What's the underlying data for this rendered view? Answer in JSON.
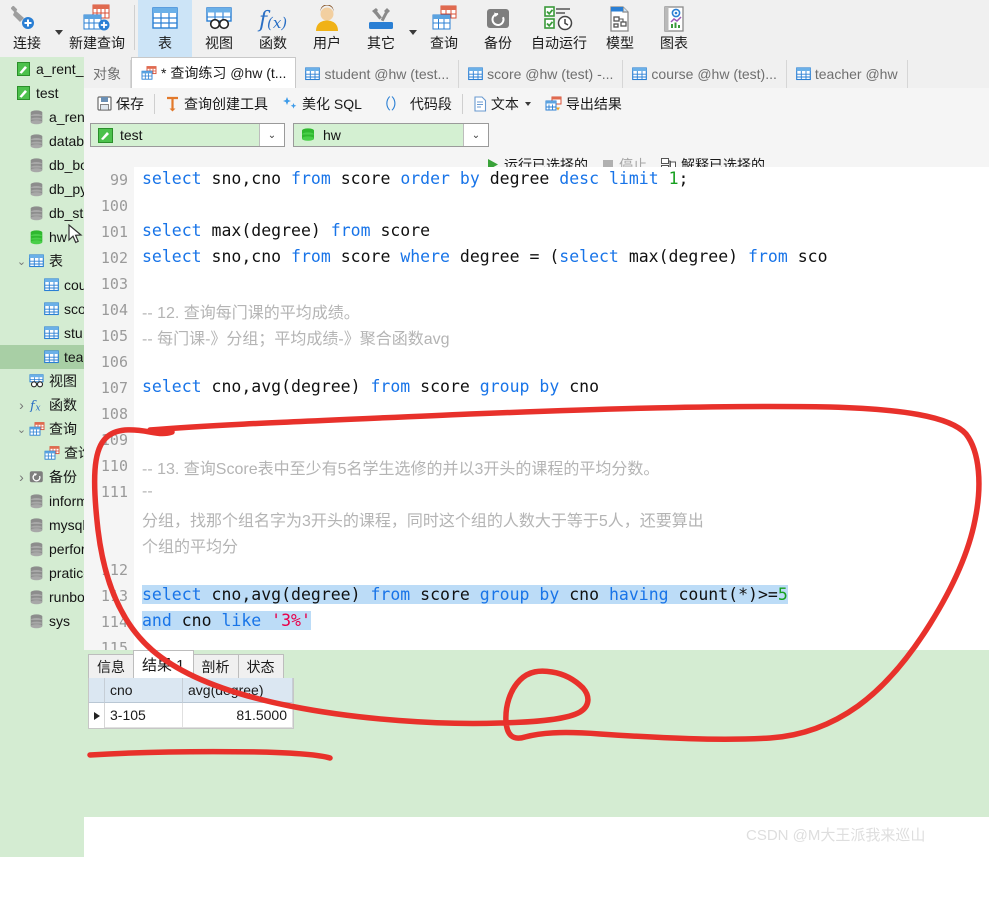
{
  "app": "Navicat",
  "colors": {
    "sidebar_bg": "#d4ecd2",
    "ribbon_bg": "#f0f0f0",
    "selection_blue": "#bcdcf7",
    "ribbon_selected": "#cce4f7",
    "keyword_blue": "#1874e8",
    "string_red": "#e8004a",
    "number_green": "#17a020",
    "comment_gray": "#b4b4b4",
    "annotation_red": "#e8312b",
    "watermark_gray": "#dedede"
  },
  "ribbon": {
    "items": [
      {
        "label": "连接",
        "icon": "connection-plus-icon",
        "selected": false,
        "caret": true
      },
      {
        "label": "新建查询",
        "icon": "new-query-icon",
        "selected": false,
        "caret": false
      },
      {
        "label": "表",
        "icon": "table-icon",
        "selected": true,
        "caret": false
      },
      {
        "label": "视图",
        "icon": "view-icon",
        "selected": false,
        "caret": false
      },
      {
        "label": "函数",
        "icon": "function-fx-icon",
        "selected": false,
        "caret": false
      },
      {
        "label": "用户",
        "icon": "user-icon",
        "selected": false,
        "caret": false
      },
      {
        "label": "其它",
        "icon": "other-tools-icon",
        "selected": false,
        "caret": true
      },
      {
        "label": "查询",
        "icon": "query-icon",
        "selected": false,
        "caret": false
      },
      {
        "label": "备份",
        "icon": "backup-icon",
        "selected": false,
        "caret": false
      },
      {
        "label": "自动运行",
        "icon": "auto-run-icon",
        "selected": false,
        "caret": false
      },
      {
        "label": "模型",
        "icon": "model-icon",
        "selected": false,
        "caret": false
      },
      {
        "label": "图表",
        "icon": "chart-icon",
        "selected": false,
        "caret": false
      }
    ]
  },
  "sidebar": {
    "items": [
      {
        "label": "a_rent_hou",
        "icon": "connection-icon",
        "indent": 1,
        "twisty": "",
        "selected": false
      },
      {
        "label": "test",
        "icon": "connection-icon",
        "indent": 1,
        "twisty": "",
        "selected": false
      },
      {
        "label": "a_rent_h",
        "icon": "database-icon",
        "indent": 2,
        "twisty": "",
        "selected": false
      },
      {
        "label": "databas",
        "icon": "database-icon",
        "indent": 2,
        "twisty": "",
        "selected": false
      },
      {
        "label": "db_bool",
        "icon": "database-icon",
        "indent": 2,
        "twisty": "",
        "selected": false
      },
      {
        "label": "db_pyto",
        "icon": "database-icon",
        "indent": 2,
        "twisty": "",
        "selected": false
      },
      {
        "label": "db_stu",
        "icon": "database-icon",
        "indent": 2,
        "twisty": "",
        "selected": false
      },
      {
        "label": "hw",
        "icon": "database-open-icon",
        "indent": 2,
        "twisty": "",
        "selected": false
      },
      {
        "label": "表",
        "icon": "table-folder-icon",
        "indent": 2,
        "twisty": "v",
        "selected": false
      },
      {
        "label": "cou",
        "icon": "table-icon",
        "indent": 3,
        "twisty": "",
        "selected": false
      },
      {
        "label": "sco",
        "icon": "table-icon",
        "indent": 3,
        "twisty": "",
        "selected": false
      },
      {
        "label": "stu",
        "icon": "table-icon",
        "indent": 3,
        "twisty": "",
        "selected": false
      },
      {
        "label": "tea",
        "icon": "table-icon",
        "indent": 3,
        "twisty": "",
        "selected": true
      },
      {
        "label": "视图",
        "icon": "view-folder-icon",
        "indent": 2,
        "twisty": "",
        "selected": false
      },
      {
        "label": "函数",
        "icon": "function-folder-icon",
        "indent": 2,
        "twisty": ">",
        "selected": false
      },
      {
        "label": "查询",
        "icon": "query-folder-icon",
        "indent": 2,
        "twisty": "v",
        "selected": false
      },
      {
        "label": "查询",
        "icon": "query-icon",
        "indent": 3,
        "twisty": "",
        "selected": false
      },
      {
        "label": "备份",
        "icon": "backup-folder-icon",
        "indent": 2,
        "twisty": ">",
        "selected": false
      },
      {
        "label": "informat",
        "icon": "database-icon",
        "indent": 2,
        "twisty": "",
        "selected": false
      },
      {
        "label": "mysql",
        "icon": "database-icon",
        "indent": 2,
        "twisty": "",
        "selected": false
      },
      {
        "label": "perform",
        "icon": "database-icon",
        "indent": 2,
        "twisty": "",
        "selected": false
      },
      {
        "label": "pratice",
        "icon": "database-icon",
        "indent": 2,
        "twisty": "",
        "selected": false
      },
      {
        "label": "runbook",
        "icon": "database-icon",
        "indent": 2,
        "twisty": "",
        "selected": false
      },
      {
        "label": "sys",
        "icon": "database-icon",
        "indent": 2,
        "twisty": "",
        "selected": false
      }
    ],
    "cursor": "mouse-pointer"
  },
  "tabs": [
    {
      "label": "对象",
      "icon": "",
      "active": false
    },
    {
      "label": "* 查询练习 @hw (t...",
      "icon": "query-icon",
      "active": true
    },
    {
      "label": "student @hw (test...",
      "icon": "table-icon",
      "active": false
    },
    {
      "label": "score @hw (test) -...",
      "icon": "table-icon",
      "active": false
    },
    {
      "label": "course @hw (test)...",
      "icon": "table-icon",
      "active": false
    },
    {
      "label": "teacher @hw",
      "icon": "table-icon",
      "active": false
    }
  ],
  "editor_toolbar": {
    "buttons": [
      {
        "label": "保存",
        "icon": "save-icon",
        "caret": false
      },
      {
        "label": "查询创建工具",
        "icon": "query-builder-icon",
        "caret": false
      },
      {
        "label": "美化 SQL",
        "icon": "beautify-icon",
        "caret": false
      },
      {
        "label": "代码段",
        "icon": "code-snippet-icon",
        "caret": false
      },
      {
        "label": "文本",
        "icon": "text-icon",
        "caret": true
      },
      {
        "label": "导出结果",
        "icon": "export-icon",
        "caret": false
      }
    ]
  },
  "connection_bar": {
    "connection": {
      "value": "test",
      "icon": "connection-icon"
    },
    "database": {
      "value": "hw",
      "icon": "database-icon"
    }
  },
  "run_bar": {
    "run_selected": {
      "label": "运行已选择的",
      "icon": "play-icon",
      "disabled": false
    },
    "stop": {
      "label": "停止",
      "icon": "stop-icon",
      "disabled": true
    },
    "explain_selected": {
      "label": "解释已选择的",
      "icon": "explain-icon",
      "disabled": false
    }
  },
  "code": {
    "lines": [
      {
        "num": "99",
        "type": "sql",
        "segments": [
          {
            "t": "select ",
            "c": "kw"
          },
          {
            "t": "sno,cno ",
            "c": ""
          },
          {
            "t": "from ",
            "c": "kw"
          },
          {
            "t": "score ",
            "c": ""
          },
          {
            "t": "order ",
            "c": "kw"
          },
          {
            "t": "by ",
            "c": "kw"
          },
          {
            "t": "degree ",
            "c": ""
          },
          {
            "t": "desc ",
            "c": "kw"
          },
          {
            "t": "limit ",
            "c": "kw"
          },
          {
            "t": "1",
            "c": "num"
          },
          {
            "t": ";",
            "c": ""
          }
        ]
      },
      {
        "num": "100",
        "type": "blank",
        "segments": []
      },
      {
        "num": "101",
        "type": "sql",
        "segments": [
          {
            "t": "select ",
            "c": "kw"
          },
          {
            "t": "max(degree) ",
            "c": ""
          },
          {
            "t": "from ",
            "c": "kw"
          },
          {
            "t": "score",
            "c": ""
          }
        ]
      },
      {
        "num": "102",
        "type": "sql",
        "segments": [
          {
            "t": "select ",
            "c": "kw"
          },
          {
            "t": "sno,cno ",
            "c": ""
          },
          {
            "t": "from ",
            "c": "kw"
          },
          {
            "t": "score ",
            "c": ""
          },
          {
            "t": "where ",
            "c": "kw"
          },
          {
            "t": "degree = (",
            "c": ""
          },
          {
            "t": "select ",
            "c": "kw"
          },
          {
            "t": "max(degree) ",
            "c": ""
          },
          {
            "t": "from ",
            "c": "kw"
          },
          {
            "t": "sco",
            "c": ""
          }
        ]
      },
      {
        "num": "103",
        "type": "blank",
        "segments": []
      },
      {
        "num": "104",
        "type": "comment",
        "segments": [
          {
            "t": "-- 12. 查询每门课的平均成绩。",
            "c": "cmt"
          }
        ]
      },
      {
        "num": "105",
        "type": "comment",
        "segments": [
          {
            "t": "-- 每门课-》分组；平均成绩-》聚合函数avg",
            "c": "cmt"
          }
        ]
      },
      {
        "num": "106",
        "type": "blank",
        "segments": []
      },
      {
        "num": "107",
        "type": "sql",
        "segments": [
          {
            "t": "select ",
            "c": "kw"
          },
          {
            "t": "cno,avg(degree) ",
            "c": ""
          },
          {
            "t": "from ",
            "c": "kw"
          },
          {
            "t": "score ",
            "c": ""
          },
          {
            "t": "group ",
            "c": "kw"
          },
          {
            "t": "by ",
            "c": "kw"
          },
          {
            "t": "cno",
            "c": ""
          }
        ]
      },
      {
        "num": "108",
        "type": "blank",
        "segments": []
      },
      {
        "num": "109",
        "type": "blank",
        "segments": []
      },
      {
        "num": "110",
        "type": "comment",
        "segments": [
          {
            "t": "-- 13. 查询Score表中至少有5名学生选修的并以3开头的课程的平均分数。",
            "c": "cmt"
          }
        ]
      },
      {
        "num": "111",
        "type": "comment",
        "segments": [
          {
            "t": "--",
            "c": "cmt"
          }
        ]
      },
      {
        "num": "",
        "type": "comment",
        "segments": [
          {
            "t": "分组，找那个组名字为3开头的课程，同时这个组的人数大于等于5人，还要算出",
            "c": "cmt"
          }
        ]
      },
      {
        "num": "",
        "type": "comment",
        "segments": [
          {
            "t": "个组的平均分",
            "c": "cmt"
          }
        ]
      },
      {
        "num": "112",
        "type": "blank",
        "segments": []
      },
      {
        "num": "113",
        "type": "sql-sel",
        "segments": [
          {
            "t": "select ",
            "c": "kw"
          },
          {
            "t": "cno,avg(degree) ",
            "c": ""
          },
          {
            "t": "from ",
            "c": "kw"
          },
          {
            "t": "score ",
            "c": ""
          },
          {
            "t": "group ",
            "c": "kw"
          },
          {
            "t": "by ",
            "c": "kw"
          },
          {
            "t": "cno ",
            "c": ""
          },
          {
            "t": "having ",
            "c": "kw"
          },
          {
            "t": "count(*)>=",
            "c": ""
          },
          {
            "t": "5",
            "c": "num"
          }
        ]
      },
      {
        "num": "114",
        "type": "sql-sel",
        "segments": [
          {
            "t": "and ",
            "c": "kw"
          },
          {
            "t": "cno ",
            "c": ""
          },
          {
            "t": "like ",
            "c": "kw"
          },
          {
            "t": "'3%'",
            "c": "str"
          }
        ]
      },
      {
        "num": "115",
        "type": "blank",
        "segments": []
      }
    ]
  },
  "result": {
    "tabs": [
      {
        "label": "信息",
        "active": false
      },
      {
        "label": "结果 1",
        "active": true
      },
      {
        "label": "剖析",
        "active": false
      },
      {
        "label": "状态",
        "active": false
      }
    ],
    "grid": {
      "columns": [
        "cno",
        "avg(degree)"
      ],
      "rows": [
        {
          "cno": "3-105",
          "avg": "81.5000"
        }
      ]
    }
  },
  "watermark": "CSDN @M大王派我来巡山"
}
